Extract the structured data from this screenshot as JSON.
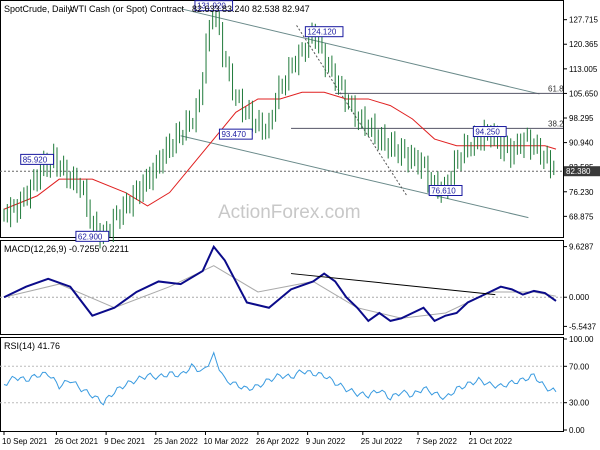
{
  "header": {
    "symbol": "SpotCrude, Daily:",
    "instrument": "WTI Cash (or Spot) Contract",
    "ohlc": "82.633 83.240 82.538 82.947"
  },
  "watermark": "ActionForex.com",
  "colors": {
    "price": "#1f7a3a",
    "ma": "#e02020",
    "macd": "#0b0b8a",
    "signal": "#aaaaaa",
    "rsi": "#3a9be0",
    "channel": "#6a8a8a",
    "label_border": "#1a1aa0"
  },
  "chart_data": [
    {
      "type": "line",
      "panel": "price",
      "title": "SpotCrude, Daily: WTI Cash (or Spot) Contract",
      "ylim": [
        63,
        133
      ],
      "y_ticks": [
        "127.715",
        "120.365",
        "113.005",
        "105.650",
        "98.295",
        "90.940",
        "83.585",
        "76.230",
        "68.875"
      ],
      "last_value": "82.380",
      "series": [
        {
          "type": "candlestick-close",
          "x": [
            0,
            2,
            3,
            5,
            7,
            9,
            10,
            12,
            14,
            16,
            18,
            20,
            22,
            24,
            26,
            28,
            29,
            31,
            33,
            35,
            37,
            38,
            40,
            42,
            44,
            46,
            48,
            49,
            51,
            52,
            54,
            56,
            58,
            60,
            62,
            64,
            66,
            68,
            70,
            72,
            74,
            76,
            77,
            78,
            80,
            82,
            84,
            86,
            88,
            90,
            92,
            94,
            96,
            98,
            100
          ],
          "values": [
            70,
            71,
            73,
            78,
            84,
            86,
            84,
            80,
            78,
            66,
            62.9,
            68,
            72,
            76,
            80,
            85,
            88,
            92,
            96,
            100,
            124,
            131.9,
            115,
            104,
            100,
            96,
            95,
            104,
            110,
            114,
            118,
            124.12,
            116,
            110,
            104,
            98,
            96,
            92,
            90,
            88,
            86,
            84,
            80,
            78,
            76.61,
            86,
            90,
            92,
            94.25,
            90,
            88,
            92,
            90,
            86,
            83
          ]
        },
        {
          "name": "",
          "type": "moving-average",
          "x": [
            0,
            6,
            10,
            16,
            22,
            26,
            30,
            34,
            38,
            42,
            46,
            50,
            54,
            58,
            62,
            66,
            70,
            74,
            78,
            82,
            86,
            90,
            94,
            98,
            100
          ],
          "values": [
            71,
            75,
            80,
            80,
            76,
            72,
            76,
            84,
            92,
            100,
            104,
            104,
            106,
            106,
            104,
            104,
            102,
            98,
            92,
            90,
            90,
            90,
            90,
            90,
            89
          ]
        }
      ],
      "labels": [
        {
          "text": "131.920",
          "x": 38,
          "y": 131.9
        },
        {
          "text": "124.120",
          "x": 58,
          "y": 124.12
        },
        {
          "text": "93.470",
          "x": 42,
          "y": 93.47
        },
        {
          "text": "85.920",
          "x": 6,
          "y": 85.92
        },
        {
          "text": "62.900",
          "x": 16,
          "y": 62.9
        },
        {
          "text": "76.610",
          "x": 80,
          "y": 76.61
        },
        {
          "text": "94.250",
          "x": 88,
          "y": 94.25
        }
      ],
      "levels": [
        {
          "text": "61.8",
          "y": 105.65
        },
        {
          "text": "38.2",
          "y": 95.2
        }
      ]
    },
    {
      "type": "line",
      "panel": "macd",
      "title": "MACD(12,26,9) -0.7255 0.2211",
      "ylim": [
        -6.8,
        10.5
      ],
      "y_ticks": [
        "9.6287",
        "0.000",
        "-5.5437"
      ],
      "series": [
        {
          "name": "",
          "x": [
            0,
            4,
            8,
            12,
            16,
            20,
            24,
            28,
            32,
            36,
            38,
            40,
            42,
            44,
            48,
            52,
            56,
            58,
            60,
            62,
            64,
            66,
            68,
            70,
            72,
            74,
            76,
            78,
            80,
            82,
            84,
            86,
            88,
            90,
            92,
            94,
            96,
            98,
            100
          ],
          "values": [
            0,
            2,
            3.5,
            2,
            -3.5,
            -2,
            1,
            3,
            2.5,
            5,
            9.6,
            7,
            3,
            -1,
            -2,
            1.5,
            3,
            4.5,
            3,
            0,
            -2,
            -4.5,
            -3,
            -4.5,
            -4,
            -3,
            -2,
            -4.5,
            -3.5,
            -3,
            -1,
            0,
            1,
            2,
            1.5,
            0.5,
            1.2,
            0.8,
            -0.7
          ]
        },
        {
          "name": "",
          "x": [
            0,
            10,
            20,
            30,
            38,
            46,
            56,
            64,
            72,
            80,
            88,
            96,
            100
          ],
          "values": [
            0,
            2.5,
            -2,
            2,
            6,
            1,
            3,
            -2,
            -4,
            -3,
            1,
            1,
            0.2
          ]
        }
      ]
    },
    {
      "type": "line",
      "panel": "rsi",
      "title": "RSI(14) 41.76",
      "ylim": [
        0,
        100
      ],
      "y_ticks": [
        "100.00",
        "70.00",
        "30.00",
        "0.00"
      ],
      "series": [
        {
          "name": "",
          "x": [
            0,
            2,
            4,
            6,
            8,
            10,
            12,
            14,
            16,
            18,
            20,
            22,
            24,
            26,
            28,
            30,
            32,
            34,
            36,
            38,
            40,
            42,
            44,
            46,
            48,
            50,
            52,
            54,
            56,
            58,
            60,
            62,
            64,
            66,
            68,
            70,
            72,
            74,
            76,
            78,
            80,
            82,
            84,
            86,
            88,
            90,
            92,
            94,
            96,
            98,
            100
          ],
          "values": [
            50,
            58,
            55,
            60,
            62,
            48,
            55,
            45,
            38,
            30,
            42,
            50,
            55,
            60,
            58,
            62,
            60,
            70,
            64,
            82,
            55,
            50,
            45,
            48,
            55,
            60,
            58,
            65,
            62,
            60,
            52,
            45,
            40,
            38,
            44,
            35,
            42,
            38,
            46,
            40,
            35,
            45,
            50,
            55,
            50,
            48,
            52,
            55,
            60,
            47,
            42
          ]
        }
      ]
    }
  ],
  "x_axis": {
    "labels": [
      "10 Sep 2021",
      "26 Oct 2021",
      "9 Dec 2021",
      "25 Jan 2022",
      "10 Mar 2022",
      "26 Apr 2022",
      "9 Jun 2022",
      "25 Jul 2022",
      "7 Sep 2022",
      "21 Oct 2022"
    ]
  }
}
